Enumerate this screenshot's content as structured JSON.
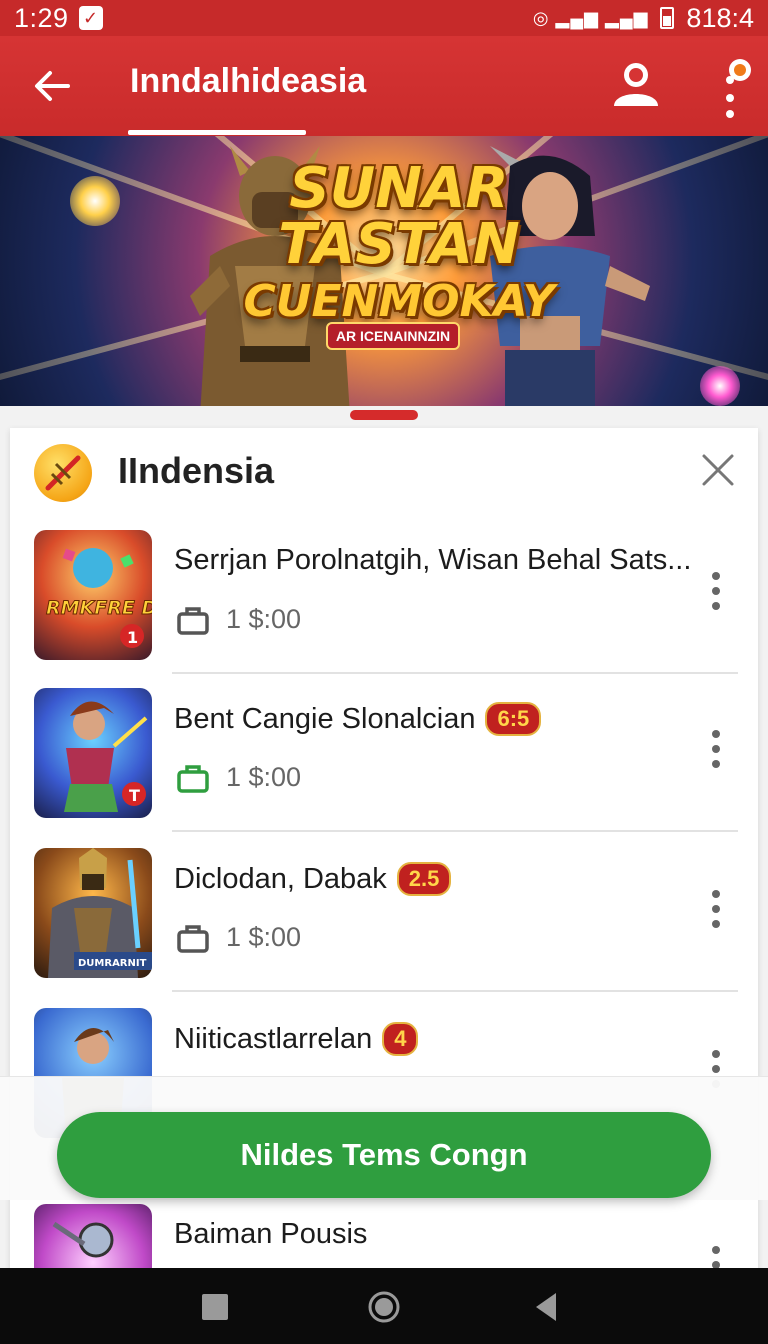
{
  "status_bar": {
    "time": "1:29",
    "battery_text": "818:4",
    "signal_text": "📶"
  },
  "app_bar": {
    "title": "Inndalhideasia"
  },
  "banner": {
    "line1": "SUNAR",
    "line2": "TASTAN",
    "line3": "CUENMOKAY",
    "sub": "AR ICENAINNZIN"
  },
  "list": {
    "heading": "IIndensia",
    "items": [
      {
        "name": "Serrjan Porolnatgih, Wisan Behal Sats...",
        "badge": "",
        "price": "1 $:00",
        "thumb_text": "RMKFRE DAOGS",
        "thumb_badge": "1",
        "bag_color": "#555555"
      },
      {
        "name": "Bent Cangie Slonalcian",
        "badge": "6:5",
        "price": "1 $:00",
        "thumb_text": "",
        "thumb_badge": "T",
        "bag_color": "#2f9e3f"
      },
      {
        "name": "Diclodan, Dabak",
        "badge": "2.5",
        "price": "1 $:00",
        "thumb_text": "DUMRARNIT",
        "thumb_badge": "",
        "bag_color": "#555555"
      },
      {
        "name": "Niiticastlarrelan",
        "badge": "4",
        "price": "",
        "thumb_text": "",
        "thumb_badge": "",
        "bag_color": "#2f9e3f"
      },
      {
        "name": "Baiman Pousis",
        "badge": "",
        "price": "",
        "thumb_text": "",
        "thumb_badge": "",
        "bag_color": "#555555"
      }
    ]
  },
  "fab": {
    "label": "Nildes Tems Congn"
  },
  "colors": {
    "primary_red": "#c62a2a",
    "action_green": "#2f9e3f",
    "badge_red": "#c0211f"
  }
}
